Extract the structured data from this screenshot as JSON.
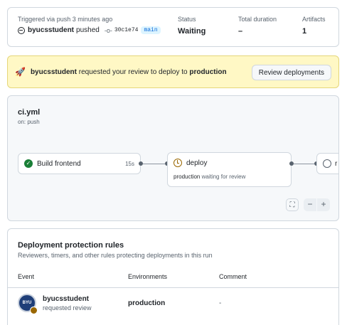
{
  "summary": {
    "trigger_label": "Triggered via push 3 minutes ago",
    "user": "byucsstudent",
    "action": "pushed",
    "commit_sha": "30c1e74",
    "branch": "main",
    "status_label": "Status",
    "status_value": "Waiting",
    "duration_label": "Total duration",
    "duration_value": "–",
    "artifacts_label": "Artifacts",
    "artifacts_value": "1"
  },
  "banner": {
    "user": "byucsstudent",
    "text": "requested your review to deploy to",
    "environment": "production",
    "button_label": "Review deployments"
  },
  "workflow": {
    "file": "ci.yml",
    "trigger": "on: push",
    "jobs": [
      {
        "name": "Build frontend",
        "duration": "15s",
        "status": "success"
      },
      {
        "name": "deploy",
        "note_env": "production",
        "note_text": "waiting for review",
        "status": "waiting"
      },
      {
        "name": "r",
        "status": "pending"
      }
    ],
    "controls": {
      "fit_icon": "⛶",
      "zoom_out": "−",
      "zoom_in": "+"
    }
  },
  "protection": {
    "title": "Deployment protection rules",
    "subtitle": "Reviewers, timers, and other rules protecting deployments in this run",
    "columns": [
      "Event",
      "Environments",
      "Comment"
    ],
    "rows": [
      {
        "avatar_text": "BYU",
        "name": "byucsstudent",
        "action": "requested review",
        "environment": "production",
        "comment": "-"
      }
    ]
  },
  "colors": {
    "banner_bg": "#fff8c5",
    "success": "#1a7f37",
    "waiting": "#9a6700",
    "link": "#0969da"
  }
}
